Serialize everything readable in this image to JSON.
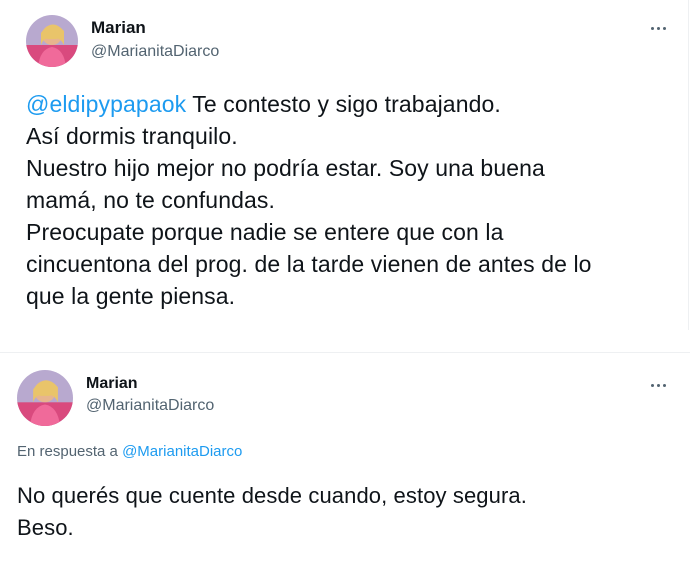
{
  "tweets": [
    {
      "author": {
        "name": "Marian",
        "handle": "@MarianitaDiarco",
        "avatar_icon": "profile-photo-avatar"
      },
      "more_icon": "more-options-icon",
      "mention": "@eldipypapaok",
      "lines": [
        " Te contesto y sigo trabajando.",
        "Así dormis tranquilo.",
        "Nuestro hijo mejor no podría estar. Soy una buena",
        "mamá, no te confundas.",
        "Preocupate porque nadie se entere que con la",
        "cincuentona del prog. de la tarde vienen de antes de lo",
        "que la gente piensa."
      ]
    },
    {
      "author": {
        "name": "Marian",
        "handle": "@MarianitaDiarco",
        "avatar_icon": "profile-photo-avatar"
      },
      "more_icon": "more-options-icon",
      "reply_prefix": "En respuesta a ",
      "reply_mention": "@MarianitaDiarco",
      "lines": [
        "No querés que cuente desde cuando, estoy segura.",
        "Beso."
      ]
    }
  ],
  "colors": {
    "mention": "#1d9bf0",
    "secondary_text": "#536471",
    "primary_text": "#0f1419"
  }
}
